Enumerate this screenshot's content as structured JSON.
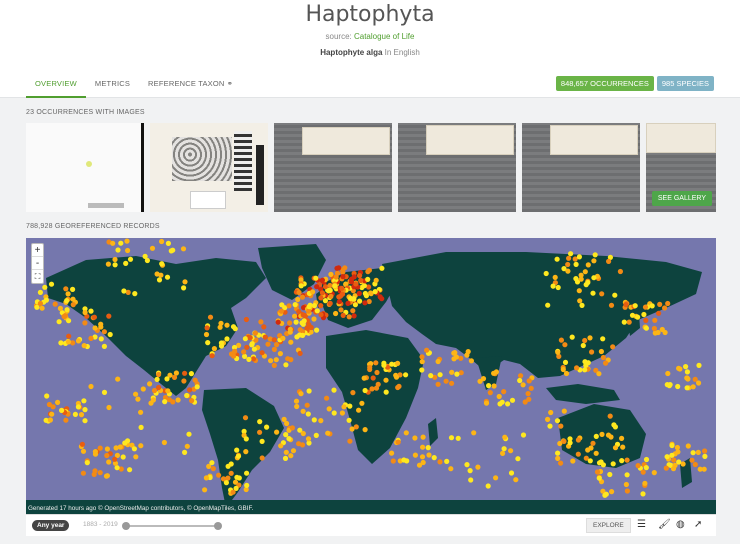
{
  "taxon": {
    "title": "Haptophyta",
    "source_prefix": "source: ",
    "source_link": "Catalogue of Life",
    "common_name": "Haptophyte alga",
    "common_lang": " In English"
  },
  "tabs": [
    {
      "label": "OVERVIEW"
    },
    {
      "label": "METRICS"
    },
    {
      "label": "REFERENCE TAXON"
    }
  ],
  "counts": {
    "occurrences": "848,657",
    "occurrences_label": " OCCURRENCES",
    "species": "985",
    "species_label": " SPECIES",
    "occ_color": "#6ab447",
    "species_color": "#7fb3c6"
  },
  "images": {
    "label": "23 OCCURRENCES WITH IMAGES",
    "gallery_button": "SEE GALLERY"
  },
  "map": {
    "label": "788,928 GEOREFERENCED RECORDS",
    "zoom_in": "+",
    "zoom_out": "-",
    "fullscreen": "⛶",
    "attribution": "Generated 17 hours ago © OpenStreetMap contributors, © OpenMapTiles, GBIF.",
    "ocean_color": "#7577ad",
    "land_color": "#0d433e",
    "hex_colors": [
      "#ffe81f",
      "#fdb515",
      "#f38a14",
      "#e85d11",
      "#d12a0e"
    ]
  },
  "timeline": {
    "any_year": "Any year",
    "range": "1883 - 2019",
    "explore": "EXPLORE"
  },
  "icons": {
    "link": "link-icon",
    "filter": "sliders-icon",
    "style": "paint-roller-icon",
    "projection": "globe-icon",
    "select": "cursor-icon"
  }
}
